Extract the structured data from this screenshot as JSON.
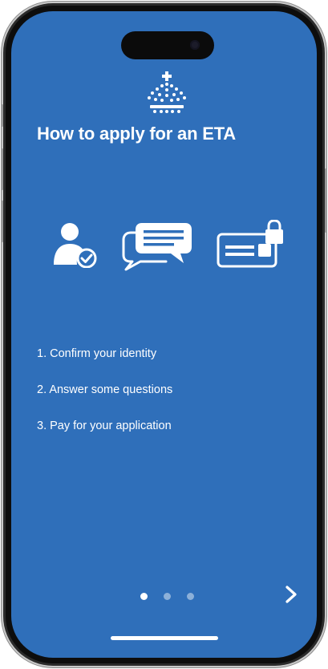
{
  "screen": {
    "title": "How to apply for an ETA",
    "background_color": "#2f6fba",
    "icons": [
      "crown-crest-icon",
      "person-verified-icon",
      "chat-bubbles-icon",
      "locked-card-icon"
    ]
  },
  "steps": [
    "1. Confirm your identity",
    "2. Answer some questions",
    "3. Pay for your application"
  ],
  "pager": {
    "total_pages": 3,
    "current_page": 1
  },
  "navigation": {
    "next_icon": "chevron-right-icon"
  }
}
